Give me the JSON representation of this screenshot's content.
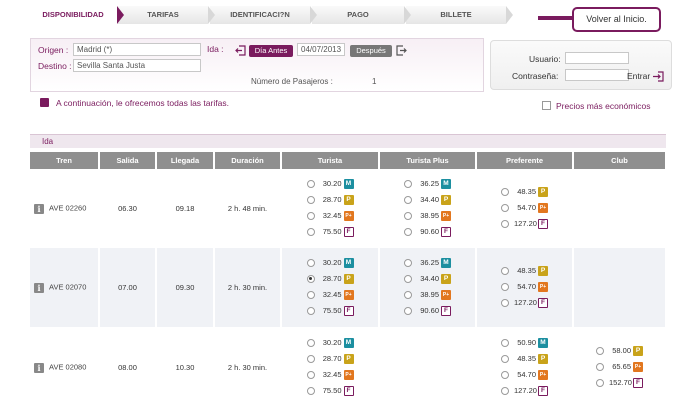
{
  "steps": [
    "DISPONIBILIDAD",
    "TARIFAS",
    "IDENTIFICACI?N",
    "PAGO",
    "BILLETE"
  ],
  "back_button": "Volver al Inicio.",
  "search": {
    "origen_label": "Origen :",
    "origen_value": "Madrid (*)",
    "destino_label": "Destino :",
    "destino_value": "Sevilla Santa Justa",
    "ida_label": "Ida :",
    "prev_day": "Día Antes",
    "date": "04/07/2013",
    "next_day": "Después",
    "pax_label": "Número de Pasajeros :",
    "pax_value": "1"
  },
  "login": {
    "user_label": "Usuario:",
    "pass_label": "Contraseña:",
    "enter": "Entrar"
  },
  "info_text": "A continuación, le ofrecemos todas las tarifas.",
  "cheapest_label": "Precios más económicos",
  "ida_title": "Ida",
  "columns": [
    "Tren",
    "Salida",
    "Llegada",
    "Duración",
    "Turista",
    "Turista Plus",
    "Preferente",
    "Club"
  ],
  "rows": [
    {
      "train": "AVE 02260",
      "salida": "06.30",
      "llegada": "09.18",
      "duracion": "2 h. 48 min.",
      "turista": [
        {
          "p": "30.20",
          "b": "M"
        },
        {
          "p": "28.70",
          "b": "P"
        },
        {
          "p": "32.45",
          "b": "P+"
        },
        {
          "p": "75.50",
          "b": "F"
        }
      ],
      "turista_plus": [
        {
          "p": "36.25",
          "b": "M"
        },
        {
          "p": "34.40",
          "b": "P"
        },
        {
          "p": "38.95",
          "b": "P+"
        },
        {
          "p": "90.60",
          "b": "F"
        }
      ],
      "preferente": [
        {
          "p": "48.35",
          "b": "P"
        },
        {
          "p": "54.70",
          "b": "P+"
        },
        {
          "p": "127.20",
          "b": "F"
        }
      ],
      "club": []
    },
    {
      "train": "AVE 02070",
      "salida": "07.00",
      "llegada": "09.30",
      "duracion": "2 h. 30 min.",
      "turista": [
        {
          "p": "30.20",
          "b": "M"
        },
        {
          "p": "28.70",
          "b": "P",
          "checked": true
        },
        {
          "p": "32.45",
          "b": "P+"
        },
        {
          "p": "75.50",
          "b": "F"
        }
      ],
      "turista_plus": [
        {
          "p": "36.25",
          "b": "M"
        },
        {
          "p": "34.40",
          "b": "P"
        },
        {
          "p": "38.95",
          "b": "P+"
        },
        {
          "p": "90.60",
          "b": "F"
        }
      ],
      "preferente": [
        {
          "p": "48.35",
          "b": "P"
        },
        {
          "p": "54.70",
          "b": "P+"
        },
        {
          "p": "127.20",
          "b": "F"
        }
      ],
      "club": []
    },
    {
      "train": "AVE 02080",
      "salida": "08.00",
      "llegada": "10.30",
      "duracion": "2 h. 30 min.",
      "turista": [
        {
          "p": "30.20",
          "b": "M"
        },
        {
          "p": "28.70",
          "b": "P"
        },
        {
          "p": "32.45",
          "b": "P+"
        },
        {
          "p": "75.50",
          "b": "F"
        }
      ],
      "turista_plus": [],
      "preferente": [
        {
          "p": "50.90",
          "b": "M"
        },
        {
          "p": "48.35",
          "b": "P"
        },
        {
          "p": "54.70",
          "b": "P+"
        },
        {
          "p": "127.20",
          "b": "F"
        }
      ],
      "club": [
        {
          "p": "58.00",
          "b": "P"
        },
        {
          "p": "65.65",
          "b": "P+"
        },
        {
          "p": "152.70",
          "b": "F"
        }
      ]
    }
  ]
}
